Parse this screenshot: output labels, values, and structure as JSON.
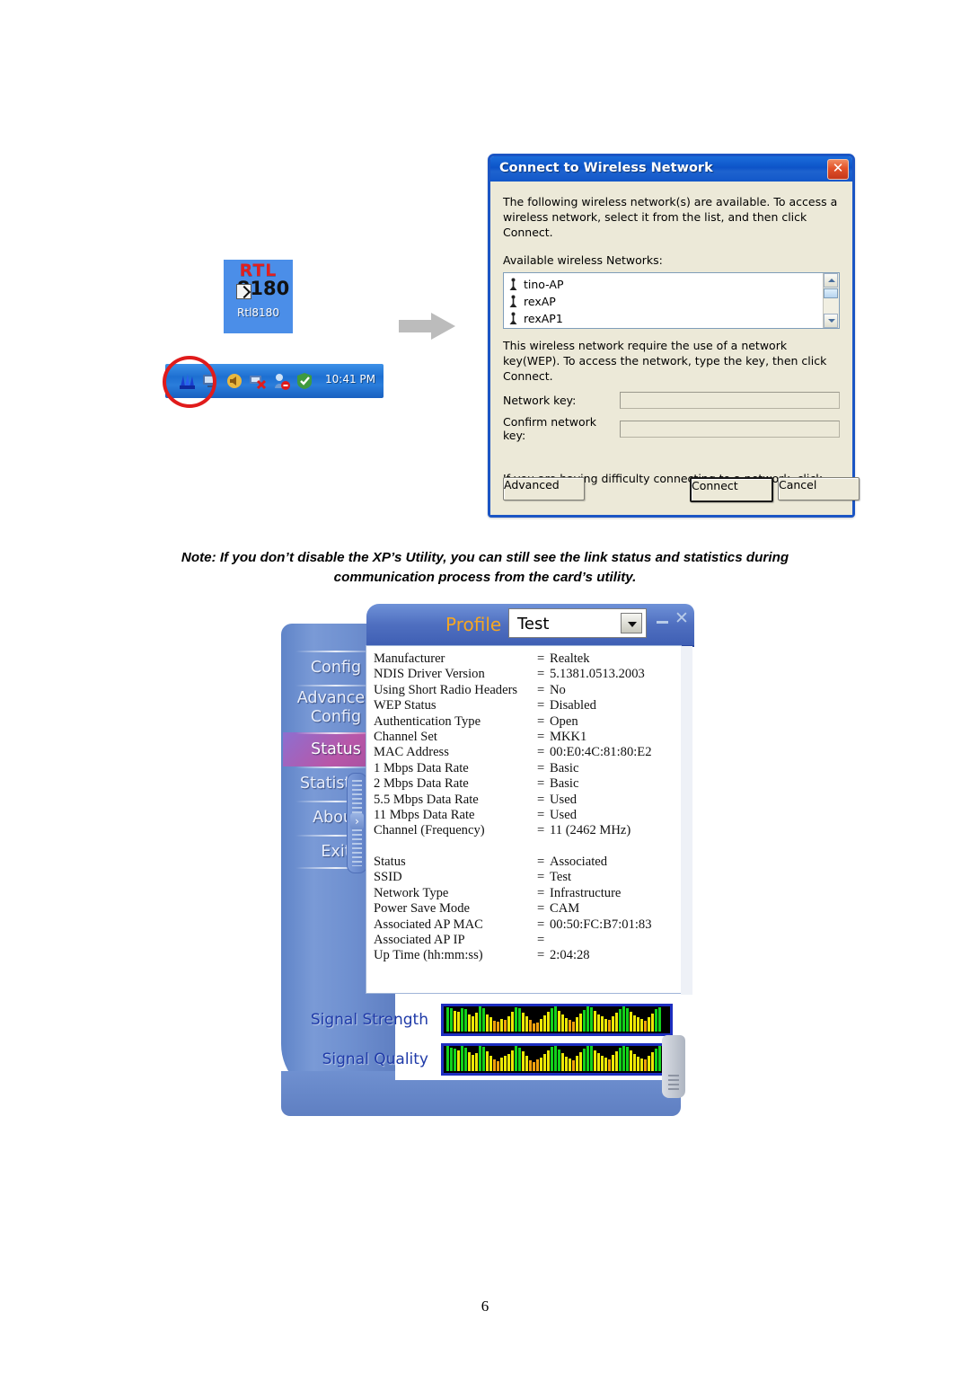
{
  "desktop_icon": {
    "brand": "RTL",
    "model": "8180",
    "label": "Rtl8180",
    "shortcut_icon": "shortcut-arrow-icon"
  },
  "flow_arrow": {
    "icon": "right-arrow-icon"
  },
  "taskbar_tray": {
    "time": "10:41 PM",
    "icons": [
      "wireless-signal-icon",
      "display-icon",
      "volume-icon",
      "network-error-icon",
      "antivirus-icon",
      "shield-icon"
    ],
    "highlight_icon": "red-circle-highlight"
  },
  "xp_dialog": {
    "title": "Connect to Wireless Network",
    "close_label": "✕",
    "intro": "The following wireless network(s) are available. To access a wireless network, select it from the list, and then click Connect.",
    "list_label": "Available wireless Networks:",
    "networks": [
      {
        "name": "tino-AP"
      },
      {
        "name": "rexAP"
      },
      {
        "name": "rexAP1"
      }
    ],
    "key_instructions": "This wireless network require the use of a network key(WEP). To access the network, type the key, then click Connect.",
    "network_key_label": "Network key:",
    "network_key_value": "",
    "confirm_key_label": "Confirm network key:",
    "confirm_key_value": "",
    "help_text": "If you are having difficulty connecting to a network, click Advanced.",
    "buttons": {
      "advanced": "Advanced",
      "connect": "Connect",
      "cancel": "Cancel"
    }
  },
  "note": {
    "line1": "Note: If you don’t disable the XP’s Utility, you can still see the link status and statistics during",
    "line2": "communication process from the card’s utility."
  },
  "utility": {
    "profile_label": "Profile",
    "profile_value": "Test",
    "minimize_label": "–",
    "close_label": "✕",
    "nav": [
      {
        "id": "config",
        "label": "Config",
        "active": false
      },
      {
        "id": "advanced-config",
        "label": "Advanced\nConfig",
        "active": false
      },
      {
        "id": "status",
        "label": "Status",
        "active": true
      },
      {
        "id": "statistics",
        "label": "Statistics",
        "active": false
      },
      {
        "id": "about",
        "label": "About",
        "active": false
      },
      {
        "id": "exit",
        "label": "Exit",
        "active": false
      }
    ],
    "grip_arrow": "›",
    "status_group1": [
      {
        "key": "Manufacturer",
        "value": "Realtek"
      },
      {
        "key": "NDIS Driver Version",
        "value": "5.1381.0513.2003"
      },
      {
        "key": "Using Short Radio Headers",
        "value": "No"
      },
      {
        "key": "WEP Status",
        "value": "Disabled"
      },
      {
        "key": "Authentication Type",
        "value": "Open"
      },
      {
        "key": "Channel Set",
        "value": "MKK1"
      },
      {
        "key": "MAC Address",
        "value": "00:E0:4C:81:80:E2"
      },
      {
        "key": "1 Mbps Data Rate",
        "value": "Basic"
      },
      {
        "key": "2 Mbps Data Rate",
        "value": "Basic"
      },
      {
        "key": "5.5 Mbps Data Rate",
        "value": "Used"
      },
      {
        "key": "11 Mbps Data Rate",
        "value": "Used"
      },
      {
        "key": "Channel (Frequency)",
        "value": "11  (2462 MHz)"
      }
    ],
    "status_group2": [
      {
        "key": "Status",
        "value": "Associated"
      },
      {
        "key": "SSID",
        "value": "Test"
      },
      {
        "key": "Network Type",
        "value": "Infrastructure"
      },
      {
        "key": "Power Save Mode",
        "value": "CAM"
      },
      {
        "key": "Associated AP MAC",
        "value": "00:50:FC:B7:01:83"
      },
      {
        "key": "Associated AP IP",
        "value": ""
      },
      {
        "key": "Up Time (hh:mm:ss)",
        "value": "2:04:28"
      }
    ],
    "equals": "=",
    "signal_strength": {
      "label": "Signal Strength",
      "bars": [
        90,
        85,
        78,
        72,
        88,
        82,
        62,
        58,
        70,
        95,
        88,
        64,
        52,
        40,
        36,
        48,
        44,
        58,
        72,
        90,
        86,
        70,
        55,
        42,
        30,
        34,
        46,
        60,
        74,
        88,
        92,
        78,
        62,
        50,
        44,
        38,
        52,
        66,
        80,
        94,
        90,
        76,
        64,
        56,
        48,
        42,
        58,
        70,
        84,
        92,
        88,
        74,
        60,
        52,
        46,
        40,
        54,
        68,
        82,
        90
      ]
    },
    "signal_quality": {
      "label": "Signal Quality",
      "bars": [
        94,
        88,
        82,
        76,
        92,
        86,
        70,
        60,
        66,
        94,
        90,
        72,
        58,
        44,
        38,
        50,
        56,
        64,
        78,
        92,
        88,
        74,
        58,
        40,
        34,
        42,
        50,
        62,
        76,
        90,
        94,
        80,
        66,
        52,
        46,
        40,
        56,
        70,
        84,
        96,
        92,
        78,
        66,
        58,
        50,
        44,
        60,
        72,
        86,
        94,
        90,
        76,
        62,
        54,
        48,
        42,
        56,
        70,
        84,
        92
      ]
    }
  },
  "page_number": "6",
  "colors": {
    "xp_title_blue": "#0d54c8",
    "xp_dialog_face": "#ece9d8",
    "utility_blue": "#6f90d0",
    "utility_accent_purple": "#b857a8",
    "profile_orange": "#f5a623",
    "highlight_red": "#e01b1b",
    "signal_green": "#12d11a",
    "signal_yellow": "#ece805",
    "signal_orange": "#f0a00c"
  }
}
